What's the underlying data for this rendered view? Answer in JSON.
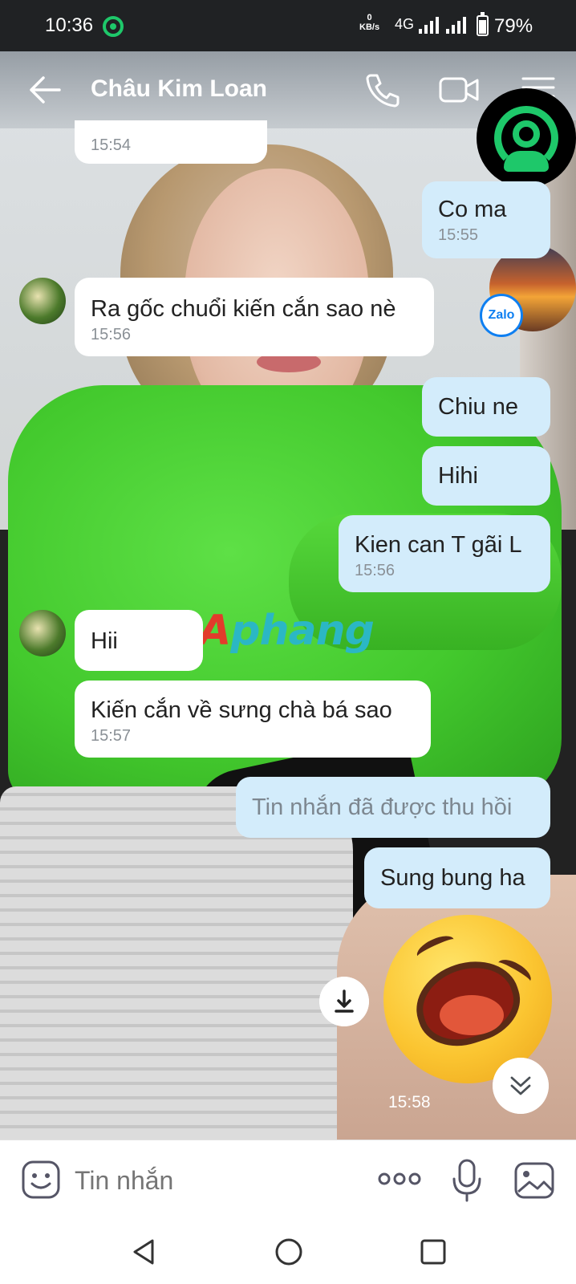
{
  "status_bar": {
    "time": "10:36",
    "net_speed_value": "0",
    "net_speed_unit": "KB/s",
    "network_type": "4G",
    "battery_percent": "79%"
  },
  "header": {
    "contact_name": "Châu Kim Loan",
    "icons": [
      "back-arrow-icon",
      "phone-icon",
      "video-call-icon",
      "menu-icon"
    ]
  },
  "floating": {
    "zalo_label": "Zalo"
  },
  "watermark": {
    "part1": "A",
    "part2": "phang"
  },
  "messages": [
    {
      "side": "in",
      "text": "",
      "time": "15:54"
    },
    {
      "side": "out",
      "text": "Co ma",
      "time": "15:55"
    },
    {
      "side": "in",
      "text": "Ra gốc chuổi kiến cắn sao nè",
      "time": "15:56"
    },
    {
      "side": "out",
      "text": "Chiu ne",
      "time": ""
    },
    {
      "side": "out",
      "text": "Hihi",
      "time": ""
    },
    {
      "side": "out",
      "text": "Kien can T gãi L",
      "time": "15:56"
    },
    {
      "side": "in",
      "text": "Hii",
      "time": ""
    },
    {
      "side": "in",
      "text": "Kiến cắn về sưng chà bá sao",
      "time": "15:57"
    },
    {
      "side": "out",
      "text": "Tin nhắn đã được thu hồi",
      "time": "",
      "recalled": true
    },
    {
      "side": "out",
      "text": "Sung bung ha",
      "time": ""
    },
    {
      "side": "out",
      "type": "sticker",
      "sticker": "laughing-face-sticker",
      "time": "15:58"
    }
  ],
  "input_bar": {
    "placeholder": "Tin nhắn",
    "icons": [
      "emoji-icon",
      "more-icon",
      "microphone-icon",
      "image-icon"
    ]
  },
  "nav_bar": {
    "icons": [
      "nav-back-icon",
      "nav-home-icon",
      "nav-recent-icon"
    ]
  },
  "colors": {
    "incoming_bubble": "#ffffff",
    "outgoing_bubble": "#d3ecfb",
    "accent_green": "#1ec86a",
    "zalo_blue": "#0e7ff1"
  }
}
